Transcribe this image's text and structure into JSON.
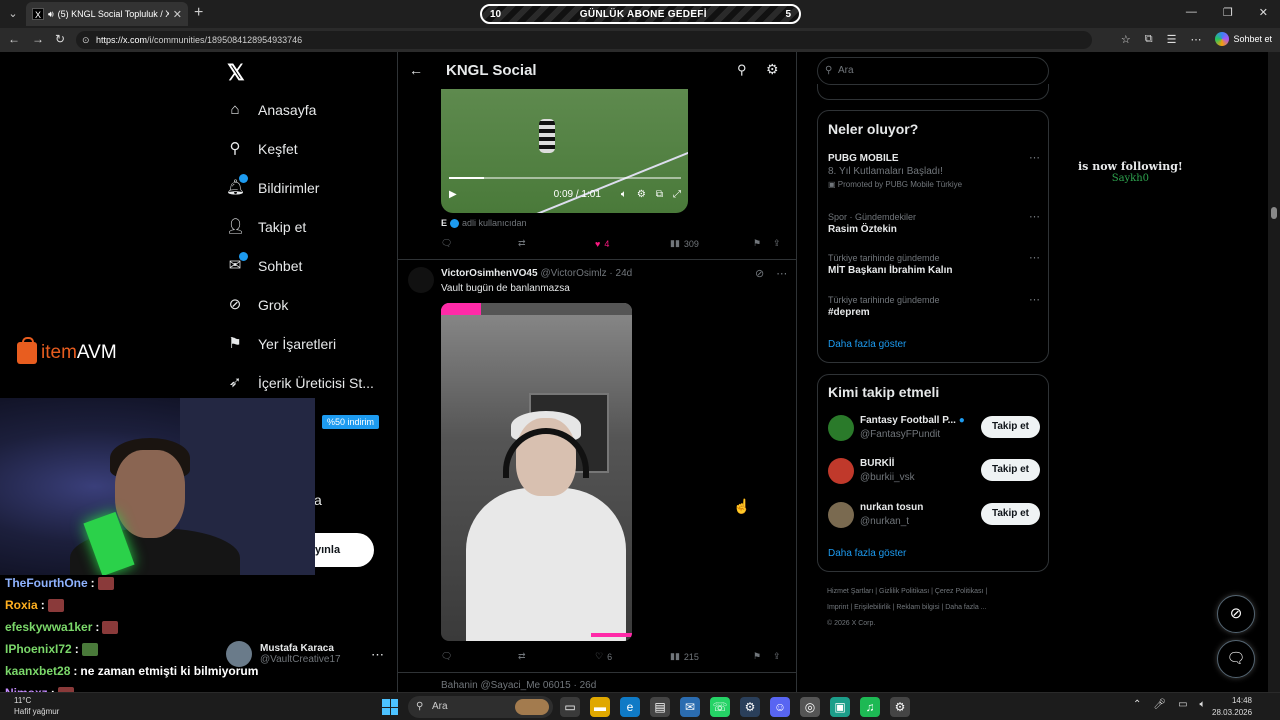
{
  "browser": {
    "tab_title": "(5) KNGL Social Topluluk / X",
    "tab_favicon": "X",
    "url_host": "https://x.com",
    "url_path": "/i/communities/1895084128954933746",
    "copilot_label": "Sohbet et"
  },
  "overlay": {
    "goal_left": "10",
    "goal_title": "GÜNLÜK ABONE GEDEFİ",
    "goal_right": "5",
    "follow_text": "is now following!",
    "follow_user": "Saykh0",
    "sponsor_it": "item",
    "sponsor_avm": "AVM",
    "discount": "%50 indirim"
  },
  "nav": {
    "items": [
      {
        "label": "Anasayfa",
        "icon": "home-icon"
      },
      {
        "label": "Keşfet",
        "icon": "search-icon"
      },
      {
        "label": "Bildirimler",
        "icon": "bell-icon"
      },
      {
        "label": "Takip et",
        "icon": "add-user-icon"
      },
      {
        "label": "Sohbet",
        "icon": "mail-icon"
      },
      {
        "label": "Grok",
        "icon": "grok-icon"
      },
      {
        "label": "Yer İşaretleri",
        "icon": "bookmark-icon"
      },
      {
        "label": "İçerik Üreticisi St...",
        "icon": "rocket-icon"
      }
    ],
    "partial_letter": "a",
    "post_button": "yınla",
    "profile_name": "Mustafa Karaca",
    "profile_handle": "@VaultCreative17"
  },
  "chat": [
    {
      "user": "TheFourthOne",
      "color": "#8fb3ff",
      "msg": "",
      "emote": "red"
    },
    {
      "user": "Roxia",
      "color": "#ffb020",
      "msg": "",
      "emote": "red"
    },
    {
      "user": "efeskywwa1ker",
      "color": "#7bd86a",
      "msg": "",
      "emote": "red"
    },
    {
      "user": "IPhoenixI72",
      "color": "#7bd86a",
      "msg": "",
      "emote": "green"
    },
    {
      "user": "kaanxbet28",
      "color": "#7bd86a",
      "msg": "ne zaman etmişti ki bilmiyorum",
      "emote": ""
    },
    {
      "user": "Nimoxz",
      "color": "#c58cff",
      "msg": "",
      "emote": "red"
    }
  ],
  "community": {
    "title": "KNGL Social",
    "video1": {
      "time": "0:09 / 1:01"
    },
    "source_flag": "E",
    "source_text": "adli kullanıcıdan",
    "tweet1_actions": {
      "like": "4",
      "views": "309"
    },
    "tweet2": {
      "name": "VictorOsimhenVO45",
      "meta": "@VictorOsimlz · 24d",
      "text": "Vault bugün de banlanmazsa",
      "likes": "6",
      "views": "215"
    },
    "tweet3_head": "Bahanin @Sayaci_Me 06015 · 26d"
  },
  "right": {
    "search_placeholder": "Ara",
    "trends_title": "Neler oluyor?",
    "trends": [
      {
        "cat": "",
        "title": "PUBG MOBILE",
        "sub": "8. Yıl Kutlamaları Başladı!",
        "promo": "Promoted by PUBG Mobile Türkiye"
      },
      {
        "cat": "Spor · Gündemdekiler",
        "title": "Rasim Öztekin",
        "sub": "",
        "promo": ""
      },
      {
        "cat": "Türkiye tarihinde gündemde",
        "title": "MİT Başkanı İbrahim Kalın",
        "sub": "",
        "promo": ""
      },
      {
        "cat": "Türkiye tarihinde gündemde",
        "title": "#deprem",
        "sub": "",
        "promo": ""
      }
    ],
    "show_more": "Daha fazla göster",
    "who_title": "Kimi takip etmeli",
    "who": [
      {
        "name": "Fantasy Football P...",
        "handle": "@FantasyFPundit",
        "btn": "Takip et",
        "color": "#2a7a2a"
      },
      {
        "name": "BURKİİ",
        "handle": "@burkii_vsk",
        "btn": "Takip et",
        "color": "#c0392b"
      },
      {
        "name": "nurkan tosun",
        "handle": "@nurkan_t",
        "btn": "Takip et",
        "color": "#7a6a50"
      }
    ],
    "who_more": "Daha fazla göster",
    "footer1": "Hizmet Şartları  |  Gizlilik Politikası  |  Çerez Politikası  |",
    "footer2": "Imprint  |  Erişilebilirlik  |  Reklam bilgisi  |  Daha fazla ...",
    "footer3": "© 2026 X Corp."
  },
  "taskbar": {
    "temp": "11°C",
    "weather": "Hafif yağmur",
    "search": "Ara",
    "time": "14:48",
    "date": "28.03.2026"
  }
}
